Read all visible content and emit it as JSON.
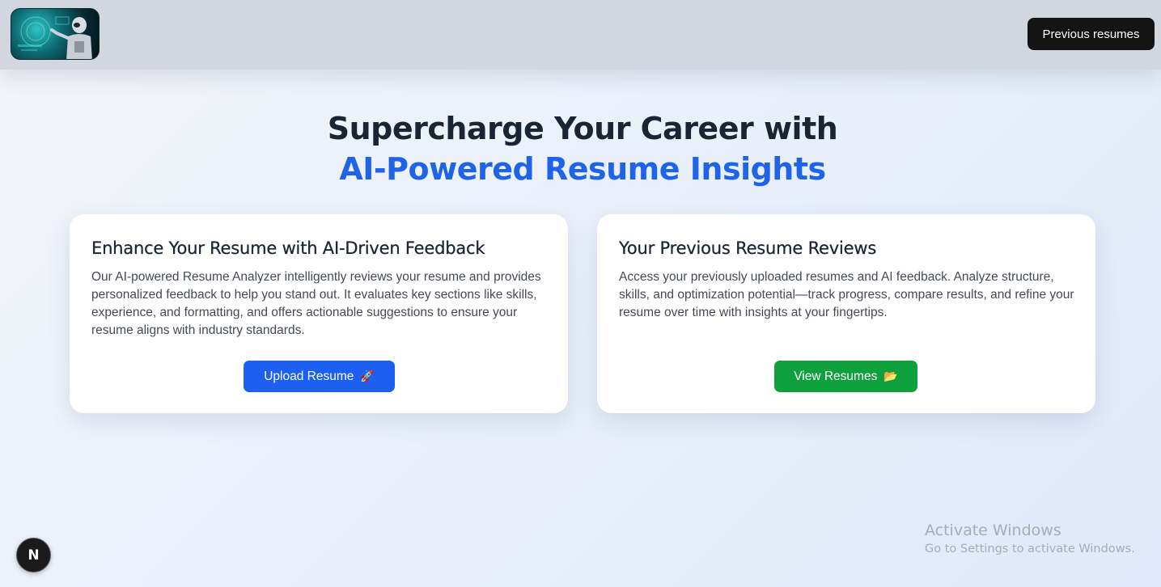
{
  "header": {
    "logo_icon": "ai-robot-logo",
    "previous_resumes_label": "Previous resumes"
  },
  "hero": {
    "line1": "Supercharge Your Career with",
    "line2": "AI-Powered Resume Insights",
    "accent_color": "#1f63e8"
  },
  "cards": [
    {
      "title": "Enhance Your Resume with AI-Driven Feedback",
      "body": "Our AI-powered Resume Analyzer intelligently reviews your resume and provides personalized feedback to help you stand out. It evaluates key sections like skills, experience, and formatting, and offers actionable suggestions to ensure your resume aligns with industry standards.",
      "button_label": "Upload Resume",
      "button_emoji": "🚀",
      "button_color": "#1d5ff0"
    },
    {
      "title": "Your Previous Resume Reviews",
      "body": "Access your previously uploaded resumes and AI feedback. Analyze structure, skills, and optimization potential—track progress, compare results, and refine your resume over time with insights at your fingertips.",
      "button_label": "View Resumes",
      "button_emoji": "📂",
      "button_color": "#0ea03c"
    }
  ],
  "nextjs_badge": {
    "label": "N",
    "icon": "nextjs-icon"
  },
  "watermark": {
    "title": "Activate Windows",
    "subtitle": "Go to Settings to activate Windows."
  }
}
